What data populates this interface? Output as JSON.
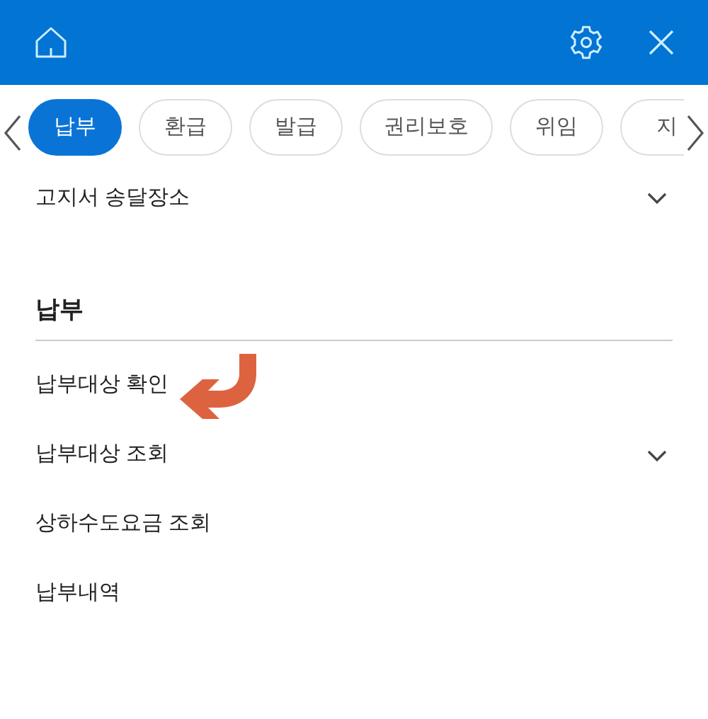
{
  "tabs": [
    {
      "label": "납부",
      "selected": true
    },
    {
      "label": "환급",
      "selected": false
    },
    {
      "label": "발급",
      "selected": false
    },
    {
      "label": "권리보호",
      "selected": false
    },
    {
      "label": "위임",
      "selected": false
    },
    {
      "label": "지",
      "selected": false
    }
  ],
  "top_items": [
    {
      "label": "고지서 송달장소",
      "expandable": true
    }
  ],
  "section": {
    "title": "납부",
    "items": [
      {
        "label": "납부대상 확인",
        "annotated": true
      },
      {
        "label": "납부대상 조회",
        "expandable": true
      },
      {
        "label": "상하수도요금 조회"
      },
      {
        "label": "납부내역"
      }
    ]
  }
}
